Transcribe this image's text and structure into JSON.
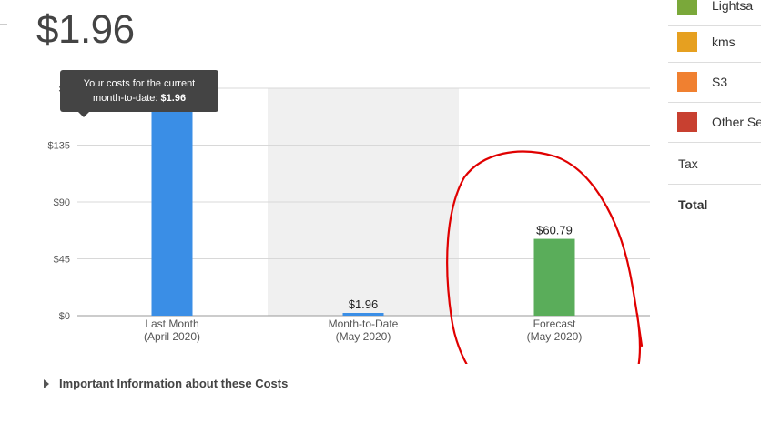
{
  "summary": {
    "amount": "$1.96"
  },
  "tooltip": {
    "line1": "Your costs for the current",
    "line2_prefix": "month-to-date: ",
    "line2_value": "$1.96"
  },
  "chart_data": {
    "type": "bar",
    "categories": [
      "Last Month\n(April 2020)",
      "Month-to-Date\n(May 2020)",
      "Forecast\n(May 2020)"
    ],
    "values": [
      180,
      1.96,
      60.79
    ],
    "data_labels": [
      "",
      "$1.96",
      "$60.79"
    ],
    "bar_colors": [
      "#3a8ee6",
      "#3a8ee6",
      "#5aad5a"
    ],
    "highlight_category": "Month-to-Date\n(May 2020)",
    "highlight_color": "#f0f0f0",
    "yticks": [
      0,
      45,
      90,
      135,
      180
    ],
    "ytick_labels": [
      "$0",
      "$45",
      "$90",
      "$135",
      "$1"
    ],
    "ylim": [
      0,
      180
    ],
    "grid": true,
    "title": "",
    "xlabel": "",
    "ylabel": ""
  },
  "annotation": {
    "type": "hand-drawn red circle",
    "around": "Forecast",
    "color": "#e00000"
  },
  "footer": {
    "important_info": "Important Information about these Costs"
  },
  "legend": {
    "items": [
      {
        "name": "Lightsa",
        "color": "#7aa83a"
      },
      {
        "name": "kms",
        "color": "#e6a020"
      },
      {
        "name": "S3",
        "color": "#f08030"
      },
      {
        "name": "Other Se",
        "color": "#c84030"
      }
    ],
    "tax_label": "Tax",
    "total_label": "Total"
  }
}
